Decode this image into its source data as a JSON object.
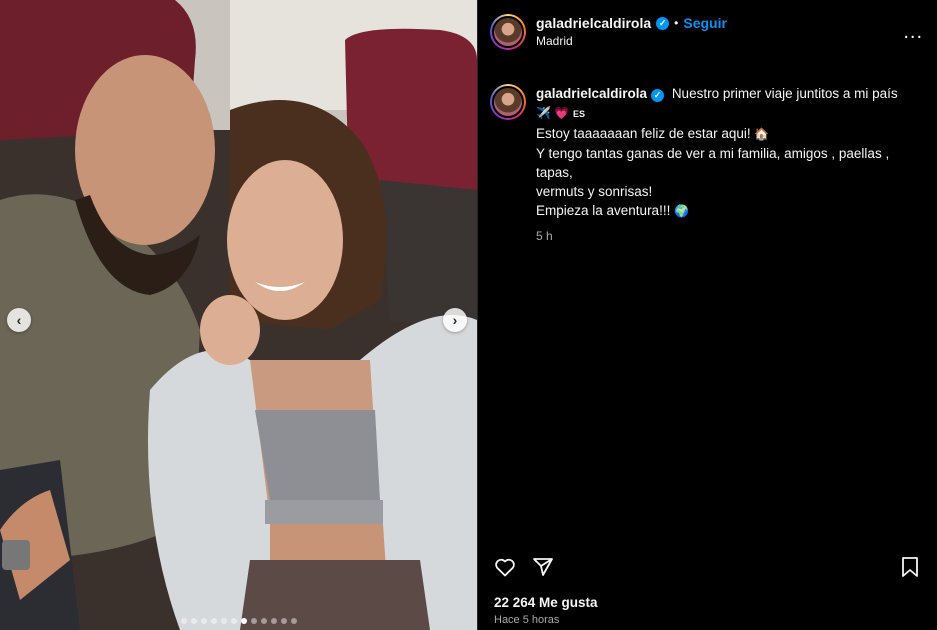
{
  "post": {
    "username": "galadrielcaldirola",
    "verified_icon": "verified-badge-icon",
    "follow_label": "Seguir",
    "separator": "•",
    "location": "Madrid",
    "more_label": "...",
    "caption": {
      "line1_text": "Nuestro primer viaje juntitos a mi país",
      "line1_emojis": "✈️ 💗",
      "lang_code": "ES",
      "line2_text": "Estoy taaaaaaan feliz de estar aqui!",
      "line2_emoji": "🏠",
      "line3": "Y tengo tantas ganas de ver a mi familia, amigos , paellas , tapas,",
      "line4": "vermuts y sonrisas!",
      "line5_text": "Empieza la aventura!!!",
      "line5_emoji": "🌍",
      "time": "5 h"
    },
    "likes": "22 264 Me gusta",
    "posted_ago": "Hace 5 horas",
    "carousel": {
      "prev_label": "‹",
      "next_label": "›",
      "total_slides": 12,
      "active_slide": 6
    }
  },
  "colors": {
    "accent": "#0095f6",
    "background": "#000000",
    "secondary_text": "#a8a8a8"
  },
  "icons": [
    "heart-icon",
    "share-icon",
    "bookmark-icon",
    "chevron-left-icon",
    "chevron-right-icon",
    "more-icon"
  ]
}
